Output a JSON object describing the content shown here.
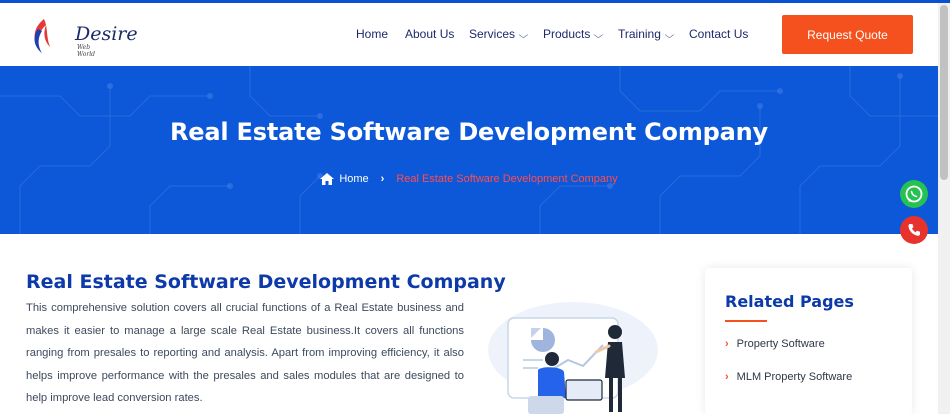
{
  "logo": {
    "name": "Desire",
    "tagline": "Web World"
  },
  "nav": {
    "home": "Home",
    "about": "About Us",
    "services": "Services",
    "products": "Products",
    "training": "Training",
    "contact": "Contact Us"
  },
  "cta": {
    "label": "Request Quote"
  },
  "hero": {
    "title": "Real Estate Software Development Company",
    "breadcrumb_home": "Home",
    "breadcrumb_current": "Real Estate Software Development Company"
  },
  "content": {
    "title": "Real Estate Software Development Company",
    "paragraph": "This comprehensive solution covers all crucial functions of a Real Estate business and makes it easier to manage a large scale Real Estate business.It covers all functions ranging from presales to reporting and analysis. Apart from improving efficiency, it also helps improve performance with the presales and sales modules that are designed to help improve lead conversion rates."
  },
  "related": {
    "title": "Related Pages",
    "items": [
      "Property Software",
      "MLM Property Software"
    ]
  },
  "colors": {
    "primary_blue": "#0d58d8",
    "heading_blue": "#0d3aa8",
    "accent_orange": "#f4511e",
    "whatsapp_green": "#25c152",
    "call_red": "#e8322e"
  }
}
